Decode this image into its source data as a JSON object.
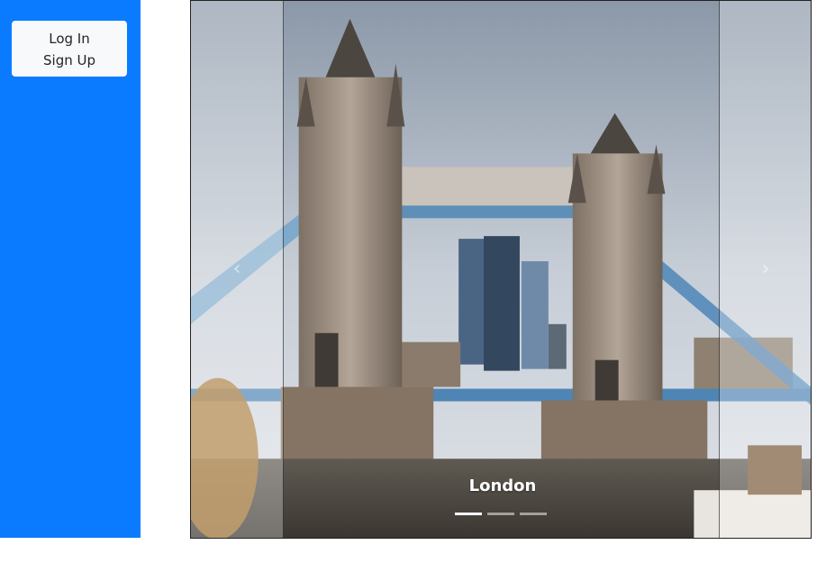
{
  "sidebar": {
    "auth": {
      "login_label": "Log In",
      "signup_label": "Sign Up"
    }
  },
  "carousel": {
    "caption": "London",
    "active_slide": 1,
    "slide_count": 3,
    "prev_icon": "chevron-left-icon",
    "next_icon": "chevron-right-icon"
  }
}
